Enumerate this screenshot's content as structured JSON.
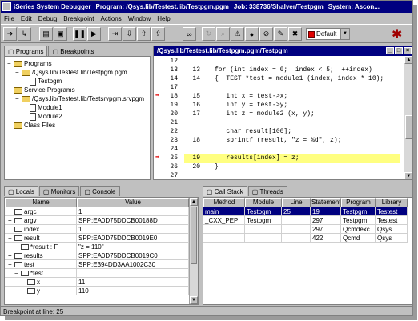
{
  "title": {
    "app": "iSeries System Debugger",
    "program": "Program: /Qsys.lib/Testest.lib/Testpgm.pgm",
    "job": "Job: 338736/Shalver/Testpgm",
    "system": "System: Ascon..."
  },
  "menu": [
    "File",
    "Edit",
    "Debug",
    "Breakpoint",
    "Actions",
    "Window",
    "Help"
  ],
  "toolbar": {
    "buttons": [
      {
        "name": "forward-icon",
        "glyph": "➔",
        "enabled": true
      },
      {
        "name": "step-into-icon",
        "glyph": "↳",
        "enabled": true
      },
      {
        "name": "program-list-icon",
        "glyph": "▤",
        "enabled": true
      },
      {
        "name": "console-icon",
        "glyph": "▣",
        "enabled": true
      },
      {
        "name": "pause-icon",
        "glyph": "❚❚",
        "enabled": true
      },
      {
        "name": "run-icon",
        "glyph": "▶",
        "enabled": true
      },
      {
        "name": "step-over-icon",
        "glyph": "⇥",
        "enabled": true
      },
      {
        "name": "step-icon",
        "glyph": "⇩",
        "enabled": true
      },
      {
        "name": "step-return-icon",
        "glyph": "⇧",
        "enabled": true
      },
      {
        "name": "step-out-icon",
        "glyph": "⇪",
        "enabled": true
      },
      {
        "name": "watch-icon",
        "glyph": "∞",
        "enabled": true
      },
      {
        "name": "refresh-icon",
        "glyph": "↻",
        "enabled": false
      },
      {
        "name": "search-icon",
        "glyph": "⌕",
        "enabled": false
      },
      {
        "name": "warning-icon",
        "glyph": "⚠",
        "enabled": true
      },
      {
        "name": "breakpoint-icon",
        "glyph": "●",
        "enabled": true
      },
      {
        "name": "disable-breakpoint-icon",
        "glyph": "⊘",
        "enabled": true
      },
      {
        "name": "clear-icon",
        "glyph": "✎",
        "enabled": true
      },
      {
        "name": "remove-icon",
        "glyph": "✖",
        "enabled": true
      }
    ],
    "highlight_combo": "Default"
  },
  "left_tabs": [
    "Programs",
    "Breakpoints"
  ],
  "tree": [
    {
      "label": "Programs",
      "type": "folder",
      "indent": 0,
      "expander": "−"
    },
    {
      "label": "/Qsys.lib/Testest.lib/Testpgm.pgm",
      "type": "folder",
      "indent": 1,
      "expander": "−"
    },
    {
      "label": "Testpgm",
      "type": "doc",
      "indent": 2,
      "expander": ""
    },
    {
      "label": "Service Programs",
      "type": "folder",
      "indent": 0,
      "expander": "−"
    },
    {
      "label": "/Qsys.lib/Testest.lib/Testsrvpgm.srvpgm",
      "type": "folder",
      "indent": 1,
      "expander": "−"
    },
    {
      "label": "Module1",
      "type": "doc",
      "indent": 2,
      "expander": ""
    },
    {
      "label": "Module2",
      "type": "doc",
      "indent": 2,
      "expander": ""
    },
    {
      "label": "Class Files",
      "type": "folder",
      "indent": 0,
      "expander": ""
    }
  ],
  "source": {
    "title": "/Qsys.lib/Testest.lib/Testpgm.pgm/Testpgm",
    "lines": [
      {
        "n1": "12",
        "n2": "",
        "code": "",
        "bp": false,
        "current": false
      },
      {
        "n1": "13",
        "n2": "13",
        "code": "for (int index = 0;  index < 5;  ++index)",
        "bp": false,
        "current": false
      },
      {
        "n1": "14",
        "n2": "14",
        "code": "{  TEST *test = module1 (index, index * 10);",
        "bp": false,
        "current": false
      },
      {
        "n1": "17",
        "n2": "",
        "code": "",
        "bp": false,
        "current": false
      },
      {
        "n1": "18",
        "n2": "15",
        "code": "   int x = test->x;",
        "bp": true,
        "current": false
      },
      {
        "n1": "19",
        "n2": "16",
        "code": "   int y = test->y;",
        "bp": false,
        "current": false
      },
      {
        "n1": "20",
        "n2": "17",
        "code": "   int z = module2 (x, y);",
        "bp": false,
        "current": false
      },
      {
        "n1": "21",
        "n2": "",
        "code": "",
        "bp": false,
        "current": false
      },
      {
        "n1": "22",
        "n2": "",
        "code": "   char result[100];",
        "bp": false,
        "current": false
      },
      {
        "n1": "23",
        "n2": "18",
        "code": "   sprintf (result, \"z = %d\", z);",
        "bp": false,
        "current": false
      },
      {
        "n1": "24",
        "n2": "",
        "code": "",
        "bp": false,
        "current": false
      },
      {
        "n1": "25",
        "n2": "19",
        "code": "   results[index] = z;",
        "bp": true,
        "current": true
      },
      {
        "n1": "26",
        "n2": "20",
        "code": "}",
        "bp": false,
        "current": false
      },
      {
        "n1": "27",
        "n2": "",
        "code": "",
        "bp": false,
        "current": false
      }
    ]
  },
  "locals_tabs": [
    "Locals",
    "Monitors",
    "Console"
  ],
  "locals": {
    "headers": [
      "Name",
      "Value"
    ],
    "rows": [
      {
        "name": "argc",
        "value": "1",
        "indent": 0,
        "exp": ""
      },
      {
        "name": "argv",
        "value": "SPP:EA0D75DDCB00188D",
        "indent": 0,
        "exp": "+"
      },
      {
        "name": "index",
        "value": "1",
        "indent": 0,
        "exp": ""
      },
      {
        "name": "result",
        "value": "SPP:EA0D75DDCB0019E0",
        "indent": 0,
        "exp": "−"
      },
      {
        "name": "*result : F",
        "value": "\"z = 110\"",
        "indent": 1,
        "exp": ""
      },
      {
        "name": "results",
        "value": "SPP:EA0D75DDCB0019C0",
        "indent": 0,
        "exp": "+"
      },
      {
        "name": "test",
        "value": "SPP:E394DD3AA1002C30",
        "indent": 0,
        "exp": "−"
      },
      {
        "name": "*test",
        "value": "",
        "indent": 1,
        "exp": "−"
      },
      {
        "name": "x",
        "value": "11",
        "indent": 2,
        "exp": ""
      },
      {
        "name": "y",
        "value": "110",
        "indent": 2,
        "exp": ""
      }
    ]
  },
  "stack_tabs": [
    "Call Stack",
    "Threads"
  ],
  "callstack": {
    "headers": [
      "Method",
      "Module",
      "Line",
      "Statement",
      "Program",
      "Library"
    ],
    "rows": [
      {
        "cells": [
          "main",
          "Testpgm",
          "25",
          "19",
          "Testpgm",
          "Testest"
        ],
        "selected": true
      },
      {
        "cells": [
          "_CXX_PEP",
          "Testpgm",
          "",
          "297",
          "Testpgm",
          "Testest"
        ],
        "selected": false
      },
      {
        "cells": [
          "",
          "",
          "",
          "297",
          "Qcmdexc",
          "Qsys"
        ],
        "selected": false
      },
      {
        "cells": [
          "",
          "",
          "",
          "422",
          "Qcmd",
          "Qsys"
        ],
        "selected": false
      }
    ]
  },
  "status": "Breakpoint at line: 25",
  "colors": {
    "title_bg": "#000080",
    "current_line": "#ffff80",
    "breakpoint_arrow": "#e00000",
    "selection": "#000080"
  }
}
